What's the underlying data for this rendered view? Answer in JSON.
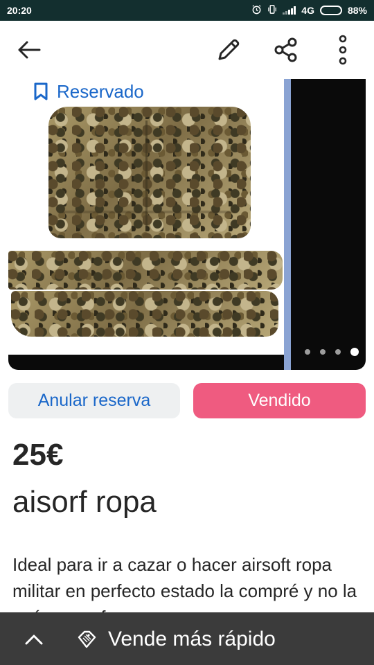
{
  "status_bar": {
    "time": "20:20",
    "network": "4G",
    "battery": "88%",
    "battery_level": 0.88
  },
  "app_bar": {
    "icons": [
      "back-arrow-icon",
      "edit-pencil-icon",
      "share-icon",
      "more-vertical-icon"
    ]
  },
  "photo": {
    "badge_label": "Reservado",
    "badge_icon": "bookmark-icon",
    "image_count": 4,
    "active_image_index": 3
  },
  "actions": {
    "cancel_label": "Anular reserva",
    "sold_label": "Vendido"
  },
  "listing": {
    "price": "25€",
    "title": "aisorf ropa",
    "description": "Ideal para ir a cazar o hacer airsoft ropa militar en perfecto estado la compré y no la usé nunca forra"
  },
  "bottom_bar": {
    "promo_label": "Vende más rápido",
    "promo_icon": "tag-icon",
    "expand_icon": "chevron-up-icon"
  },
  "colors": {
    "status_bar": "#132f2f",
    "accent_blue": "#1a67c9",
    "sold_pink": "#ef5b80",
    "cancel_bg": "#eef0f1",
    "bottom_bar": "#3b3b3b",
    "text": "#262626"
  }
}
